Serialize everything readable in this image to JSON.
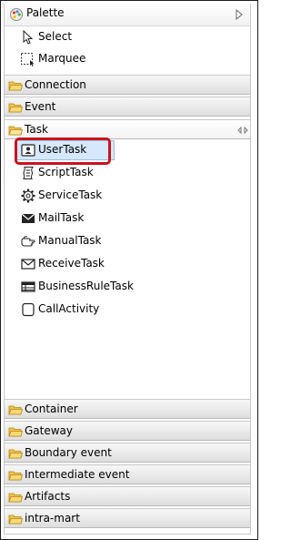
{
  "palette": {
    "title": "Palette",
    "tools": [
      {
        "label": "Select",
        "icon": "arrow-cursor-icon"
      },
      {
        "label": "Marquee",
        "icon": "marquee-icon"
      }
    ],
    "drawers_top": [
      {
        "label": "Connection",
        "icon": "folder-icon"
      },
      {
        "label": "Event",
        "icon": "folder-icon"
      }
    ],
    "task_drawer": {
      "label": "Task",
      "entries": [
        {
          "label": "UserTask",
          "icon": "user-task-icon",
          "selected": true
        },
        {
          "label": "ScriptTask",
          "icon": "script-task-icon"
        },
        {
          "label": "ServiceTask",
          "icon": "service-task-icon"
        },
        {
          "label": "MailTask",
          "icon": "mail-task-icon"
        },
        {
          "label": "ManualTask",
          "icon": "manual-task-icon"
        },
        {
          "label": "ReceiveTask",
          "icon": "receive-task-icon"
        },
        {
          "label": "BusinessRuleTask",
          "icon": "business-rule-task-icon"
        },
        {
          "label": "CallActivity",
          "icon": "call-activity-icon"
        }
      ]
    },
    "drawers_bottom": [
      {
        "label": "Container",
        "icon": "folder-icon"
      },
      {
        "label": "Gateway",
        "icon": "folder-icon"
      },
      {
        "label": "Boundary event",
        "icon": "folder-icon"
      },
      {
        "label": "Intermediate event",
        "icon": "folder-icon"
      },
      {
        "label": "Artifacts",
        "icon": "folder-icon"
      },
      {
        "label": "intra-mart",
        "icon": "folder-icon"
      }
    ],
    "colors": {
      "highlight": "#c8141e",
      "selection_bg": "#d6e8fb",
      "folder": "#f0c24e"
    }
  }
}
